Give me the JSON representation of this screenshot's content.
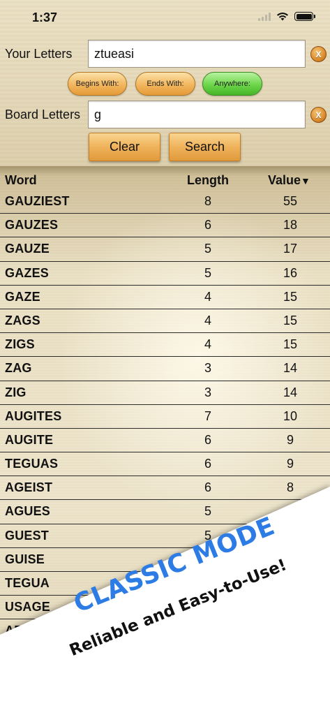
{
  "status_bar": {
    "time": "1:37"
  },
  "inputs": {
    "your_letters": {
      "label": "Your Letters",
      "value": "ztueasi",
      "clear": "X"
    },
    "board_letters": {
      "label": "Board Letters",
      "value": "g",
      "clear": "X"
    }
  },
  "modes": [
    {
      "label": "Begins With:",
      "selected": false
    },
    {
      "label": "Ends With:",
      "selected": false
    },
    {
      "label": "Anywhere:",
      "selected": true
    }
  ],
  "buttons": {
    "clear": "Clear",
    "search": "Search"
  },
  "table": {
    "headers": {
      "word": "Word",
      "length": "Length",
      "value": "Value",
      "sort_indicator": "▼"
    },
    "rows": [
      {
        "word": "GAUZIEST",
        "length": "8",
        "value": "55"
      },
      {
        "word": "GAUZES",
        "length": "6",
        "value": "18"
      },
      {
        "word": "GAUZE",
        "length": "5",
        "value": "17"
      },
      {
        "word": "GAZES",
        "length": "5",
        "value": "16"
      },
      {
        "word": "GAZE",
        "length": "4",
        "value": "15"
      },
      {
        "word": "ZAGS",
        "length": "4",
        "value": "15"
      },
      {
        "word": "ZIGS",
        "length": "4",
        "value": "15"
      },
      {
        "word": "ZAG",
        "length": "3",
        "value": "14"
      },
      {
        "word": "ZIG",
        "length": "3",
        "value": "14"
      },
      {
        "word": "AUGITES",
        "length": "7",
        "value": "10"
      },
      {
        "word": "AUGITE",
        "length": "6",
        "value": "9"
      },
      {
        "word": "TEGUAS",
        "length": "6",
        "value": "9"
      },
      {
        "word": "AGEIST",
        "length": "6",
        "value": "8"
      },
      {
        "word": "AGUES",
        "length": "5",
        "value": ""
      },
      {
        "word": "GUEST",
        "length": "5",
        "value": ""
      },
      {
        "word": "GUISE",
        "length": "",
        "value": ""
      },
      {
        "word": "TEGUA",
        "length": "",
        "value": ""
      },
      {
        "word": "USAGE",
        "length": "",
        "value": ""
      },
      {
        "word": "AE",
        "length": "",
        "value": ""
      }
    ]
  },
  "banner": {
    "title": "CLASSIC MODE",
    "subtitle": "Reliable and Easy-to-Use!",
    "title_color": "#2d7ce6"
  },
  "colors": {
    "button_orange": "#efb25a",
    "selected_green": "#6dd54a",
    "row_divider": "#2b2b2b"
  }
}
